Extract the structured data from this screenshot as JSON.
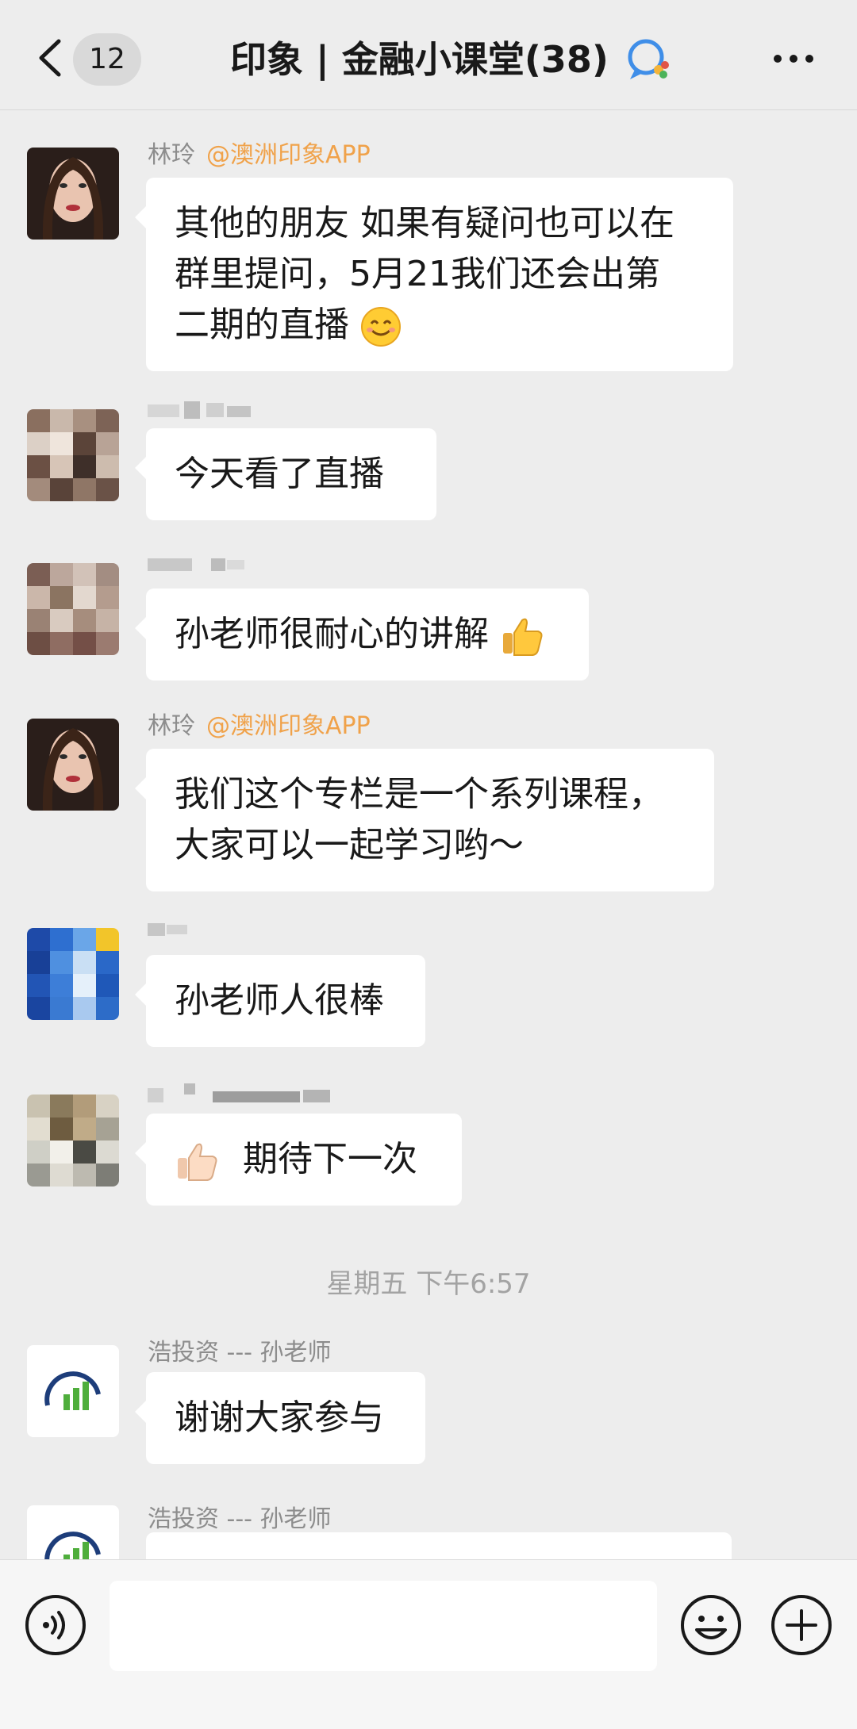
{
  "header": {
    "back_count": "12",
    "title": "印象 | 金融小课堂(38)"
  },
  "messages": [
    {
      "sender": "林玲",
      "sender_tag": "@澳洲印象APP",
      "lines": [
        "其他的朋友 如果有疑问也可以在",
        "群里提问，5月21我们还会出第",
        "二期的直播"
      ],
      "emoji": "smile-icon"
    },
    {
      "sender": "",
      "lines": [
        "今天看了直播"
      ]
    },
    {
      "sender": "",
      "lines": [
        "孙老师很耐心的讲解"
      ],
      "emoji": "thumbs-up-icon"
    },
    {
      "sender": "林玲",
      "sender_tag": "@澳洲印象APP",
      "lines": [
        "我们这个专栏是一个系列课程，",
        "大家可以一起学习哟～"
      ]
    },
    {
      "sender": "",
      "lines": [
        "孙老师人很棒"
      ]
    },
    {
      "sender": "",
      "lines": [
        "期待下一次"
      ],
      "emoji": "thumbs-up-icon"
    },
    {
      "sender": "浩投资 --- 孙老师",
      "lines": [
        "谢谢大家参与"
      ]
    },
    {
      "sender": "浩投资 --- 孙老师",
      "lines": [
        ""
      ]
    }
  ],
  "time_label": "星期五 下午6:57",
  "input": {
    "value": ""
  },
  "colors": {
    "background": "#ededed",
    "bubble": "#ffffff",
    "sender_tag": "#f0a24a",
    "sender_name": "#8d8d8d"
  }
}
